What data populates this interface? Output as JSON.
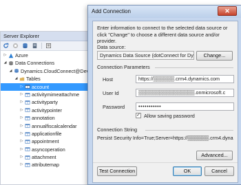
{
  "server_explorer": {
    "title": "Server Explorer",
    "toolbar": [
      "refresh-icon",
      "stop-icon",
      "connect-database-icon",
      "connect-server-icon",
      "properties-icon"
    ],
    "tree": [
      {
        "arrow": "▷",
        "icon": "azure-icon",
        "label": "Azure"
      },
      {
        "arrow": "◢",
        "icon": "data-connections-icon",
        "label": "Data Connections"
      },
      {
        "arrow": "◢",
        "icon": "database-icon",
        "label": "Dynamics.CloudConnect@Dev"
      },
      {
        "arrow": "◢",
        "icon": "folder-icon",
        "label": "Tables"
      },
      {
        "arrow": "▷",
        "icon": "table-icon",
        "label": "account",
        "selected": true
      },
      {
        "arrow": "▷",
        "icon": "table-icon",
        "label": "activitymimeattachme"
      },
      {
        "arrow": "▷",
        "icon": "table-icon",
        "label": "activityparty"
      },
      {
        "arrow": "▷",
        "icon": "table-icon",
        "label": "activitypointer"
      },
      {
        "arrow": "▷",
        "icon": "table-icon",
        "label": "annotation"
      },
      {
        "arrow": "▷",
        "icon": "table-icon",
        "label": "annualfiscalcalendar"
      },
      {
        "arrow": "▷",
        "icon": "table-icon",
        "label": "applicationfile"
      },
      {
        "arrow": "▷",
        "icon": "table-icon",
        "label": "appointment"
      },
      {
        "arrow": "▷",
        "icon": "table-icon",
        "label": "asyncoperation"
      },
      {
        "arrow": "▷",
        "icon": "table-icon",
        "label": "attachment"
      },
      {
        "arrow": "▷",
        "icon": "table-icon",
        "label": "attributemap"
      }
    ]
  },
  "dialog": {
    "title": "Add Connection",
    "close_glyph": "✕",
    "intro": "Enter information to connect to the selected data source or click \"Change\" to choose a different data source and/or provider.",
    "data_source_label": "Data source:",
    "data_source_value": "Dynamics Data Source (dotConnect for Dynami",
    "change_button": "Change...",
    "connection_params_label": "Connection Parameters",
    "host_label": "Host",
    "host_value": "https://▒▒▒▒▒▒.crm4.dynamics.com",
    "user_label": "User Id",
    "user_value": "▒▒▒▒▒▒▒▒▒▒▒▒▒▒▒▒.onmicrosoft.c",
    "password_label": "Password",
    "password_value": "•••••••••••",
    "save_password_checked": "✓",
    "save_password_label": "Allow saving password",
    "connection_string_label": "Connection String",
    "connection_string_value": "Persist Security Info=True;Server=https://▒▒▒▒▒▒.crm4.dyna",
    "advanced_button": "Advanced...",
    "test_button": "Test Connection",
    "ok_button": "OK",
    "cancel_button": "Cancel"
  },
  "colors": {
    "selection": "#3399ff",
    "dialog_frame": "#c5d6ee",
    "close_button": "#c5432c"
  }
}
